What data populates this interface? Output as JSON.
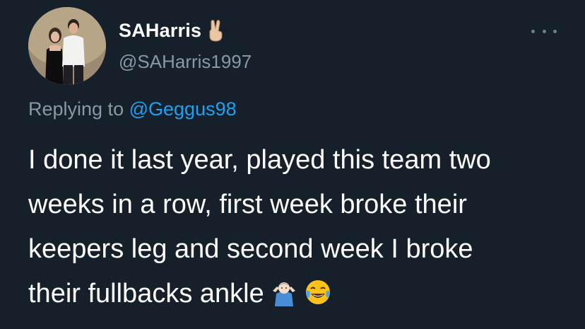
{
  "tweet": {
    "display_name": "SAHarris",
    "name_emoji": "victory-hand-emoji",
    "handle": "@SAHarris1997",
    "reply_prefix": "Replying to",
    "reply_to": "@Geggus98",
    "text_lines": [
      "I done it last year, played this team two",
      "weeks in a row, first week broke their",
      "keepers leg and second week I broke",
      "their fullbacks ankle"
    ],
    "trailing_emojis": [
      "person-shrugging-emoji",
      "face-with-tears-of-joy-emoji"
    ]
  },
  "colors": {
    "background": "#15202b",
    "primary_text": "#ffffff",
    "secondary_text": "#8899a6",
    "link": "#1da1f2"
  }
}
